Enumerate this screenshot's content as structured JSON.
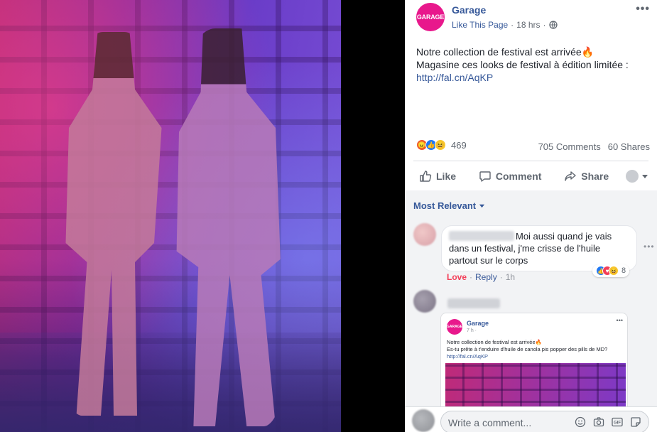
{
  "post": {
    "page_name": "Garage",
    "avatar_text": "GARAGE",
    "like_page": "Like This Page",
    "time": "18 hrs",
    "sep": "·",
    "line1": "Notre collection de festival est arrivée🔥",
    "line2": "Magasine ces looks de festival à édition limitée :",
    "link": "http://fal.cn/AqKP",
    "reaction_count": "469",
    "comments_count": "705 Comments",
    "shares_count": "60 Shares",
    "more": "•••"
  },
  "actions": {
    "like": "Like",
    "comment": "Comment",
    "share": "Share"
  },
  "comments": {
    "sort_label": "Most Relevant",
    "c1_text": "Moi aussi quand je vais dans un festival, j'me crisse de l'huile partout sur le corps",
    "c1_reactions": "8",
    "c1_love": "Love",
    "c1_reply": "Reply",
    "c1_time": "1h",
    "c1_sep": "·",
    "c1_more": "•••",
    "shared": {
      "name": "Garage",
      "avatar_text": "GARAGE",
      "time": "7 h ·",
      "line1": "Notre collection de festival est arrivée🔥",
      "line2": "Es-tu prête à t'enduire d'huile de canola pis popper des pills de MD?",
      "link": "http://fal.cn/AqKP",
      "dots": "•••"
    },
    "write_placeholder": "Write a comment..."
  },
  "icons": [
    "globe-icon",
    "thumbs-up-icon",
    "comment-icon",
    "share-icon",
    "caret-down-icon",
    "emoji-icon",
    "camera-icon",
    "gif-icon",
    "sticker-icon"
  ],
  "colors": {
    "brand": "#e8188c",
    "link": "#365899",
    "love": "#f33e58"
  }
}
